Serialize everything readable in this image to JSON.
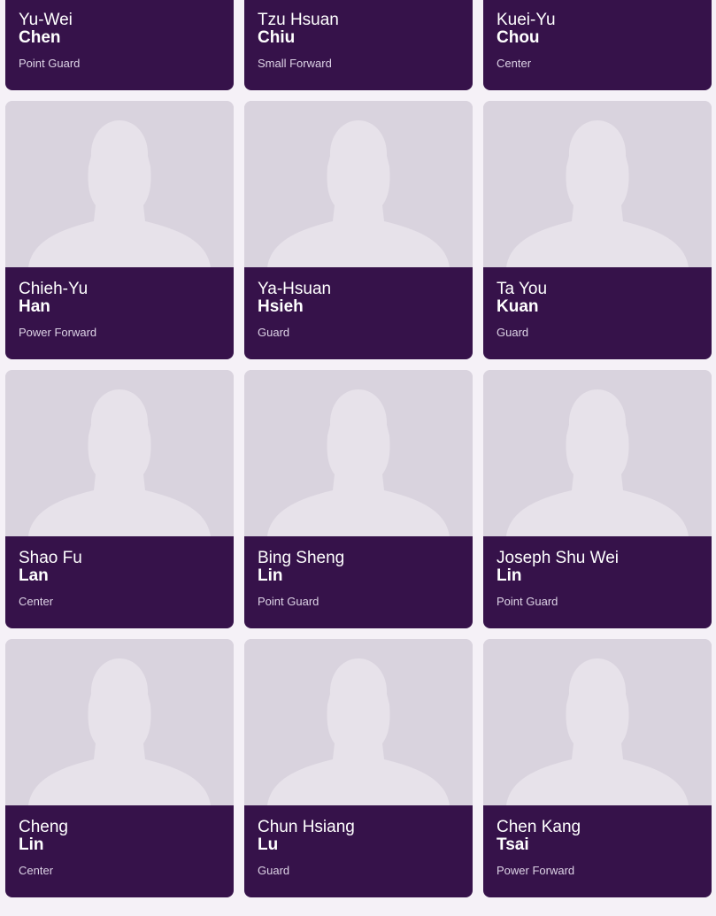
{
  "colors": {
    "page_background": "#f5f1f7",
    "photo_background": "#d9d3de",
    "silhouette": "#e7e2ea",
    "card_info_background": "#36124a",
    "name_text": "#ffffff",
    "position_text": "#ddd3e6"
  },
  "placeholder_icon": "person-silhouette-icon",
  "players": [
    {
      "first_name": "Yu-Wei",
      "last_name": "Chen",
      "position": "Point Guard"
    },
    {
      "first_name": "Tzu Hsuan",
      "last_name": "Chiu",
      "position": "Small Forward"
    },
    {
      "first_name": "Kuei-Yu",
      "last_name": "Chou",
      "position": "Center"
    },
    {
      "first_name": "Chieh-Yu",
      "last_name": "Han",
      "position": "Power Forward"
    },
    {
      "first_name": "Ya-Hsuan",
      "last_name": "Hsieh",
      "position": "Guard"
    },
    {
      "first_name": "Ta You",
      "last_name": "Kuan",
      "position": "Guard"
    },
    {
      "first_name": "Shao Fu",
      "last_name": "Lan",
      "position": "Center"
    },
    {
      "first_name": "Bing Sheng",
      "last_name": "Lin",
      "position": "Point Guard"
    },
    {
      "first_name": "Joseph Shu Wei",
      "last_name": "Lin",
      "position": "Point Guard"
    },
    {
      "first_name": "Cheng",
      "last_name": "Lin",
      "position": "Center"
    },
    {
      "first_name": "Chun Hsiang",
      "last_name": "Lu",
      "position": "Guard"
    },
    {
      "first_name": "Chen Kang",
      "last_name": "Tsai",
      "position": "Power Forward"
    }
  ]
}
